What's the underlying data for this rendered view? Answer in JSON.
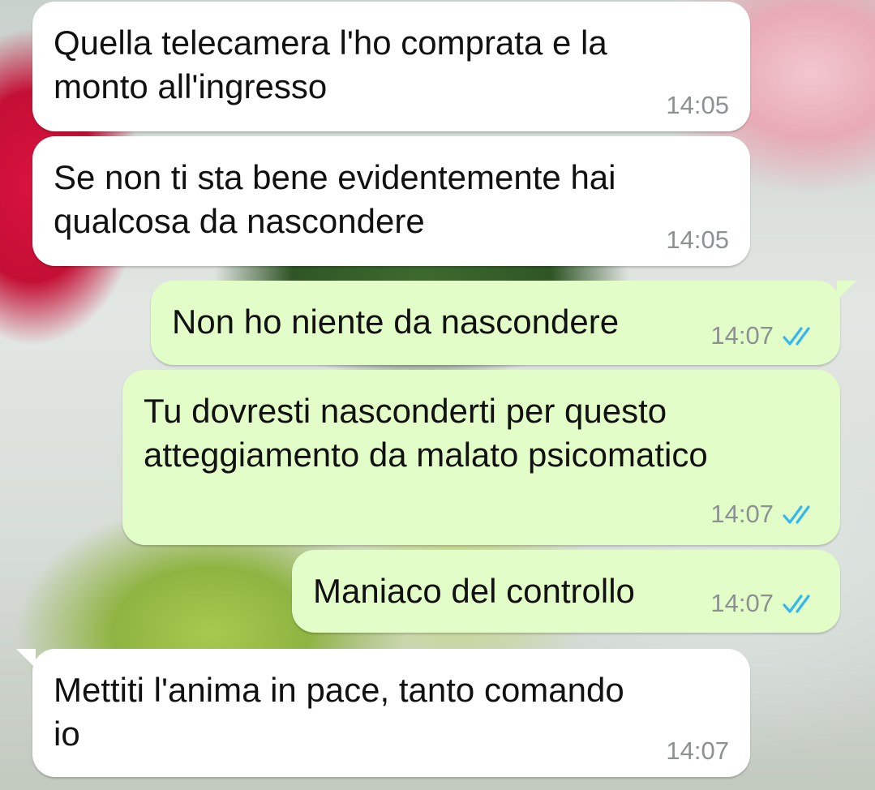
{
  "messages": [
    {
      "direction": "incoming",
      "text": "Quella telecamera l'ho comprata e la\nmonto all'ingresso",
      "time": "14:05"
    },
    {
      "direction": "incoming",
      "text": "Se non ti sta bene evidentemente hai\nqualcosa da nascondere",
      "time": "14:05"
    },
    {
      "direction": "outgoing",
      "text": "Non ho niente da nascondere",
      "time": "14:07",
      "status_icon": "double-check-read-icon"
    },
    {
      "direction": "outgoing",
      "text": "Tu dovresti nasconderti per questo\natteggiamento da malato psicomatico",
      "time": "14:07",
      "status_icon": "double-check-read-icon"
    },
    {
      "direction": "outgoing",
      "text": "Maniaco del controllo",
      "time": "14:07",
      "status_icon": "double-check-read-icon"
    },
    {
      "direction": "incoming",
      "text": "Mettiti l'anima in pace, tanto comando\nio",
      "time": "14:07"
    }
  ],
  "colors": {
    "incoming_bubble": "#ffffff",
    "outgoing_bubble": "#e2fdc8",
    "timestamp": "#8c9192",
    "read_check": "#34b7f1"
  }
}
